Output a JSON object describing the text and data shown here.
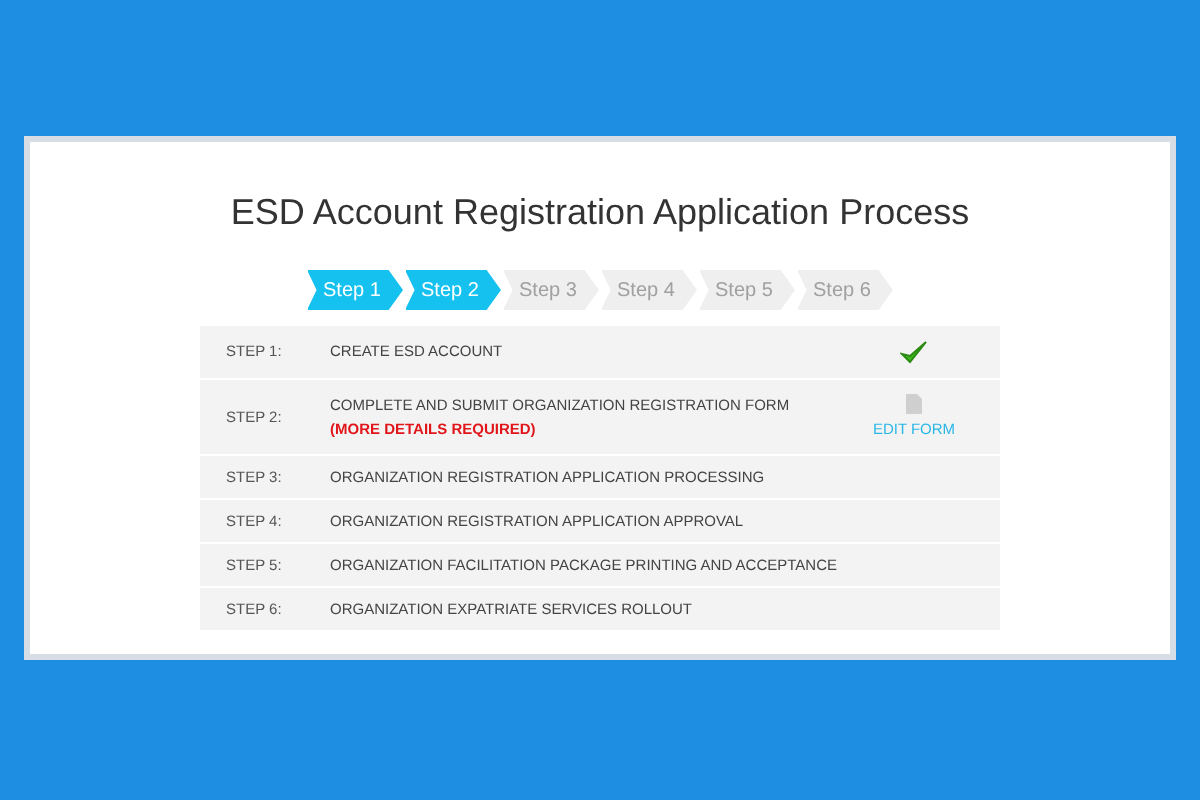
{
  "title": "ESD Account Registration Application Process",
  "steps": [
    {
      "label": "Step 1",
      "selected": true
    },
    {
      "label": "Step 2",
      "selected": true
    },
    {
      "label": "Step 3",
      "selected": false
    },
    {
      "label": "Step 4",
      "selected": false
    },
    {
      "label": "Step 5",
      "selected": false
    },
    {
      "label": "Step 6",
      "selected": false
    }
  ],
  "rows": [
    {
      "step": "STEP 1:",
      "task": "CREATE ESD ACCOUNT",
      "kind": "done"
    },
    {
      "step": "STEP 2:",
      "task": "COMPLETE AND SUBMIT ORGANIZATION REGISTRATION FORM",
      "note": "(MORE DETAILS REQUIRED)",
      "kind": "edit",
      "action": "EDIT FORM"
    },
    {
      "step": "STEP 3:",
      "task": "ORGANIZATION REGISTRATION APPLICATION PROCESSING",
      "kind": "pending"
    },
    {
      "step": "STEP 4:",
      "task": "ORGANIZATION REGISTRATION APPLICATION APPROVAL",
      "kind": "pending"
    },
    {
      "step": "STEP 5:",
      "task": "ORGANIZATION FACILITATION PACKAGE PRINTING AND ACCEPTANCE",
      "kind": "pending"
    },
    {
      "step": "STEP 6:",
      "task": "ORGANIZATION EXPATRIATE SERVICES ROLLOUT",
      "kind": "pending"
    }
  ]
}
